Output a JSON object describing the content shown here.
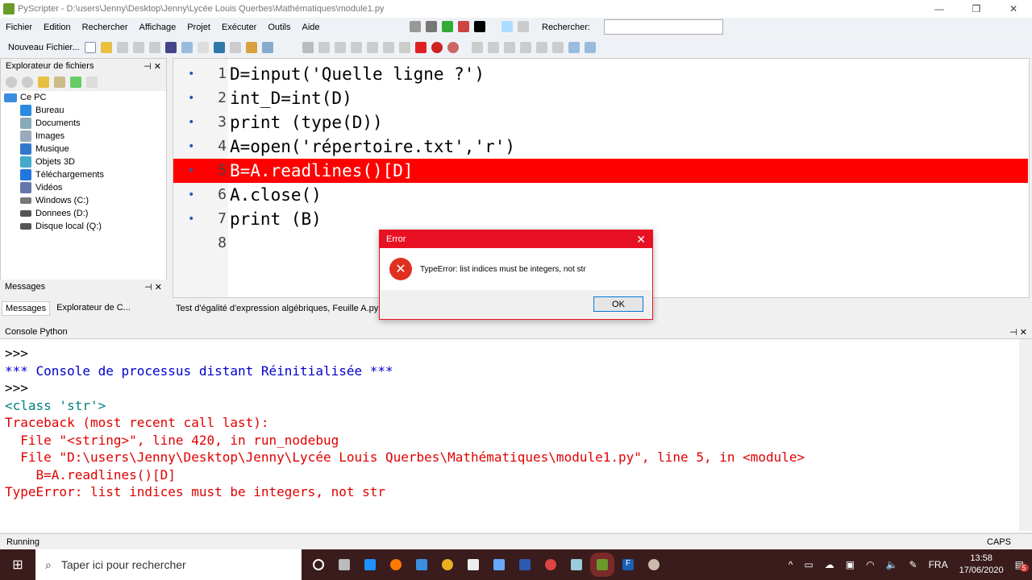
{
  "window": {
    "title": "PyScripter - D:\\users\\Jenny\\Desktop\\Jenny\\Lycée Louis Querbes\\Mathématiques\\module1.py"
  },
  "menu": [
    "Fichier",
    "Edition",
    "Rechercher",
    "Affichage",
    "Projet",
    "Exécuter",
    "Outils",
    "Aide"
  ],
  "search": {
    "label": "Rechercher:",
    "value": ""
  },
  "toolbar": {
    "new_file": "Nouveau Fichier..."
  },
  "explorer": {
    "title": "Explorateur de fichiers",
    "root": "Ce PC",
    "items": [
      "Bureau",
      "Documents",
      "Images",
      "Musique",
      "Objets 3D",
      "Téléchargements",
      "Vidéos",
      "Windows (C:)",
      "Donnees (D:)",
      "Disque local (Q:)"
    ]
  },
  "messages": {
    "title": "Messages",
    "tabs": [
      "Messages",
      "Explorateur de C..."
    ]
  },
  "editor": {
    "lines": [
      {
        "n": "1",
        "code": "D=input('Quelle ligne ?')"
      },
      {
        "n": "2",
        "code": "int_D=int(D)"
      },
      {
        "n": "3",
        "code": "print (type(D))"
      },
      {
        "n": "4",
        "code": "A=open('répertoire.txt','r')"
      },
      {
        "n": "5",
        "code": "B=A.readlines()[D]"
      },
      {
        "n": "6",
        "code": "A.close()"
      },
      {
        "n": "7",
        "code": "print (B)"
      },
      {
        "n": "8",
        "code": ""
      }
    ],
    "error_line": 5,
    "error_color": "#ff0000",
    "tab": "Test d'égalité d'expression algébriques, Feuille A.py"
  },
  "dialog": {
    "title": "Error",
    "message": "TypeError: list indices must be integers, not str",
    "ok": "OK"
  },
  "console": {
    "title": "Console Python",
    "lines": [
      {
        "text": ">>>",
        "color": "#000"
      },
      {
        "text": "*** Console de processus distant Réinitialisée ***",
        "color": "#0000cc"
      },
      {
        "text": ">>>",
        "color": "#000"
      },
      {
        "text": "<class 'str'>",
        "color": "#008080"
      },
      {
        "text": "Traceback (most recent call last):",
        "color": "#e00000"
      },
      {
        "text": "  File \"<string>\", line 420, in run_nodebug",
        "color": "#e00000"
      },
      {
        "text": "  File \"D:\\users\\Jenny\\Desktop\\Jenny\\Lycée Louis Querbes\\Mathématiques\\module1.py\", line 5, in <module>",
        "color": "#e00000"
      },
      {
        "text": "    B=A.readlines()[D]",
        "color": "#e00000"
      },
      {
        "text": "TypeError: list indices must be integers, not str",
        "color": "#e00000"
      }
    ]
  },
  "status": {
    "left": "Running",
    "caps": "CAPS"
  },
  "taskbar": {
    "search_placeholder": "Taper ici pour rechercher",
    "lang": "FRA",
    "time": "13:58",
    "date": "17/06/2020",
    "notifications": "5"
  }
}
